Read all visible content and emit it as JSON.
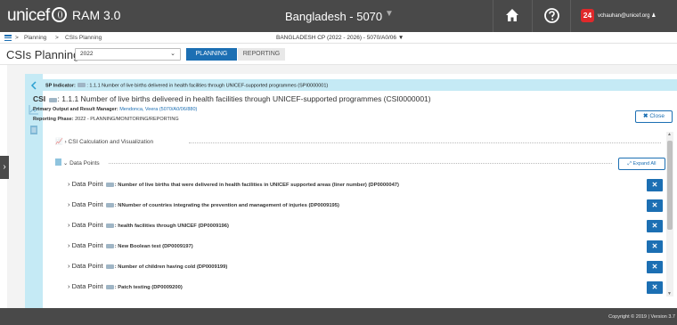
{
  "topbar": {
    "logo_text": "unicef",
    "app_name": "RAM 3.0",
    "country": "Bangladesh - 5070",
    "notification_count": "24",
    "user_email": "vchauhan@unicef.org"
  },
  "breadcrumb": {
    "items": [
      "Planning",
      "CSIs Planning"
    ],
    "separator": ">",
    "cp_title": "BANGLADESH CP (2022 - 2026) - 5070/A0/06"
  },
  "page": {
    "title": "CSIs Planning",
    "year": "2022",
    "tabs": [
      {
        "label": "PLANNING",
        "active": true
      },
      {
        "label": "REPORTING",
        "active": false
      }
    ]
  },
  "sp_indicator": {
    "label": "SP Indicator:",
    "text": ": 1.1.1 Number of live births delivered in health facilities through UNICEF-supported programmes (SPI0000001)"
  },
  "csi": {
    "label": "CSI",
    "text": ": 1.1.1 Number of live births delivered in health facilities through UNICEF-supported programmes (CSI0000001)",
    "manager_label": "Primary Output and Result Manager:",
    "manager_value": "Mendonca, Veera (5070/A0/06/880)",
    "phase_label": "Reporting Phase:",
    "phase_value": "2022 - PLANNING/MONITORING/REPORTING",
    "close_label": "Close"
  },
  "sections": {
    "calc_label": "CSI Calculation and Visualization",
    "datapoints_label": "Data Points",
    "expand_all_label": "Expand All"
  },
  "data_points": [
    {
      "label": "Data Point",
      "desc": ": Number of live births that were delivered in health facilities in UNICEF supported areas (liner number) (DP0000047)"
    },
    {
      "label": "Data Point",
      "desc": ": NNumber of countries integrating the prevention and management of injuries (DP0009195)"
    },
    {
      "label": "Data Point",
      "desc": ": health facilities through UNICEF (DP0009196)"
    },
    {
      "label": "Data Point",
      "desc": ": New Boolean test (DP0009197)"
    },
    {
      "label": "Data Point",
      "desc": ": Number of children having cold (DP0009199)"
    },
    {
      "label": "Data Point",
      "desc": ": Patch testing (DP0009200)"
    }
  ],
  "footer": {
    "copyright": "Copyright © 2019 | Version 3.7"
  },
  "colors": {
    "topbar": "#494949",
    "accent": "#1c6fb3",
    "banner": "#c5eaf5",
    "badge": "#e0292b"
  },
  "icons": [
    "globe-icon",
    "home-icon",
    "help-icon",
    "user-icon",
    "menu-icon",
    "chevron-down-icon",
    "chart-icon",
    "document-icon",
    "collapse-icon",
    "close-icon",
    "expand-icon"
  ]
}
